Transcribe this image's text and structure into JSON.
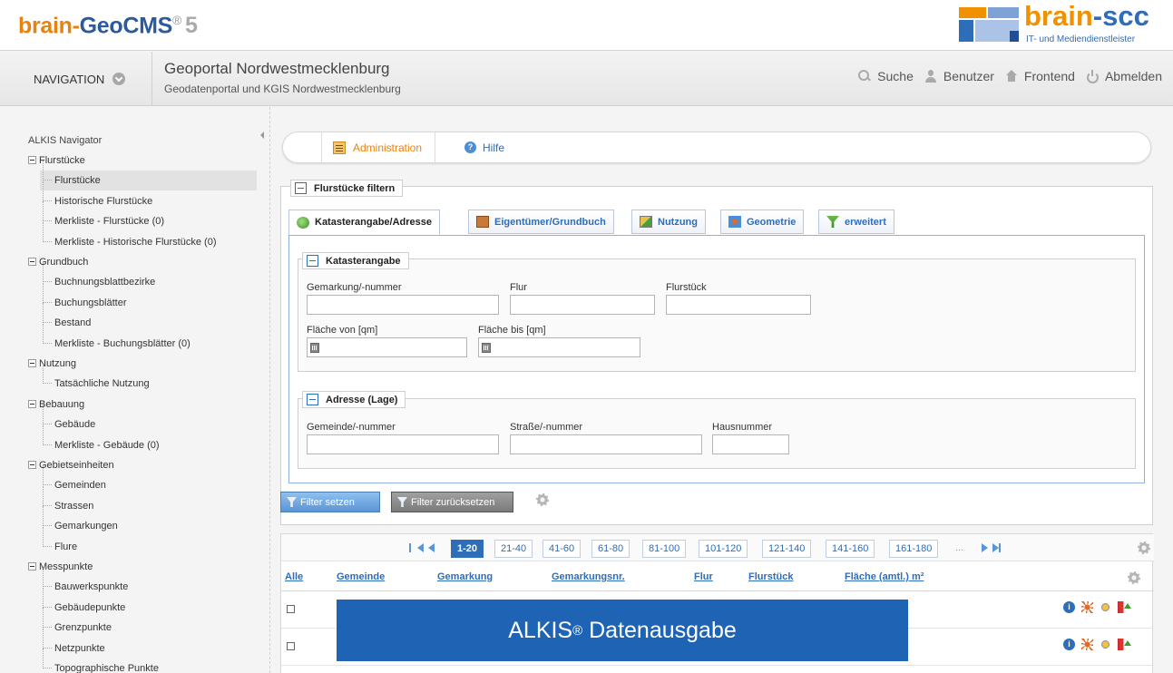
{
  "brand": {
    "name_part1": "brain-",
    "name_part2": "GeoCMS",
    "reg": "®",
    "version": "5"
  },
  "logo": {
    "part1": "brain",
    "part2": "-scc",
    "tagline": "IT- und Mediendienstleister"
  },
  "nav": {
    "toggle_label": "NAVIGATION",
    "title": "Geoportal Nordwestmecklenburg",
    "subtitle": "Geodatenportal und KGIS Nordwestmecklenburg",
    "actions": [
      {
        "label": "Suche",
        "icon": "search-icon"
      },
      {
        "label": "Benutzer",
        "icon": "user-icon"
      },
      {
        "label": "Frontend",
        "icon": "home-icon"
      },
      {
        "label": "Abmelden",
        "icon": "power-icon"
      }
    ]
  },
  "sidebar": {
    "title": "ALKIS Navigator",
    "items": [
      {
        "label": "Flurstücke",
        "type": "group"
      },
      {
        "label": "Flurstücke",
        "type": "child",
        "selected": true
      },
      {
        "label": "Historische Flurstücke",
        "type": "child"
      },
      {
        "label": "Merkliste - Flurstücke (0)",
        "type": "child"
      },
      {
        "label": "Merkliste - Historische Flurstücke (0)",
        "type": "child"
      },
      {
        "label": "Grundbuch",
        "type": "group"
      },
      {
        "label": "Buchnungsblattbezirke",
        "type": "child"
      },
      {
        "label": "Buchungsblätter",
        "type": "child"
      },
      {
        "label": "Bestand",
        "type": "child"
      },
      {
        "label": "Merkliste - Buchungsblätter (0)",
        "type": "child"
      },
      {
        "label": "Nutzung",
        "type": "group"
      },
      {
        "label": "Tatsächliche Nutzung",
        "type": "child"
      },
      {
        "label": "Bebauung",
        "type": "group"
      },
      {
        "label": "Gebäude",
        "type": "child"
      },
      {
        "label": "Merkliste - Gebäude (0)",
        "type": "child"
      },
      {
        "label": "Gebietseinheiten",
        "type": "group"
      },
      {
        "label": "Gemeinden",
        "type": "child"
      },
      {
        "label": "Strassen",
        "type": "child"
      },
      {
        "label": "Gemarkungen",
        "type": "child"
      },
      {
        "label": "Flure",
        "type": "child"
      },
      {
        "label": "Messpunkte",
        "type": "group"
      },
      {
        "label": "Bauwerkspunkte",
        "type": "child"
      },
      {
        "label": "Gebäudepunkte",
        "type": "child"
      },
      {
        "label": "Grenzpunkte",
        "type": "child"
      },
      {
        "label": "Netzpunkte",
        "type": "child"
      },
      {
        "label": "Topographische Punkte",
        "type": "child"
      }
    ]
  },
  "main": {
    "tabs": [
      {
        "label": "Administration",
        "icon": "admin-icon"
      },
      {
        "label": "Hilfe",
        "icon": "help-icon"
      }
    ],
    "filter": {
      "legend": "Flurstücke filtern",
      "tabs": [
        {
          "label": "Katasterangabe/Adresse",
          "icon": "globe-icon",
          "active": true
        },
        {
          "label": "Eigentümer/Grundbuch",
          "icon": "owner-icon"
        },
        {
          "label": "Nutzung",
          "icon": "usage-icon"
        },
        {
          "label": "Geometrie",
          "icon": "geometry-icon"
        },
        {
          "label": "erweitert",
          "icon": "extended-filter-icon"
        }
      ],
      "kataster": {
        "legend": "Katasterangabe",
        "gemarkung_label": "Gemarkung/-nummer",
        "flur_label": "Flur",
        "flurstueck_label": "Flurstück",
        "flaeche_von_label": "Fläche von [qm]",
        "flaeche_bis_label": "Fläche bis [qm]",
        "gemarkung_value": "",
        "flur_value": "",
        "flurstueck_value": "",
        "flaeche_von_value": "",
        "flaeche_bis_value": ""
      },
      "adresse": {
        "legend": "Adresse (Lage)",
        "gemeinde_label": "Gemeinde/-nummer",
        "strasse_label": "Straße/-nummer",
        "hausnummer_label": "Hausnummer",
        "gemeinde_value": "",
        "strasse_value": "",
        "hausnummer_value": ""
      },
      "apply_label": "Filter setzen",
      "reset_label": "Filter zurücksetzen"
    },
    "results": {
      "pages": [
        "1-20",
        "21-40",
        "41-60",
        "61-80",
        "81-100",
        "101-120",
        "121-140",
        "141-160",
        "161-180"
      ],
      "active_page": "1-20",
      "ellipsis": "...",
      "columns": [
        "Alle",
        "Gemeinde",
        "Gemarkung",
        "Gemarkungsnr.",
        "Flur",
        "Flurstück",
        "Fläche (amtl.) m²"
      ],
      "row_count_visible": 2
    }
  },
  "overlay": {
    "text": "ALKIS",
    "sup": "®",
    "text2": " Datenausgabe"
  },
  "colors": {
    "brand_orange": "#e8820e",
    "brand_blue": "#2e6db8",
    "overlay_blue": "#1f64b4"
  }
}
